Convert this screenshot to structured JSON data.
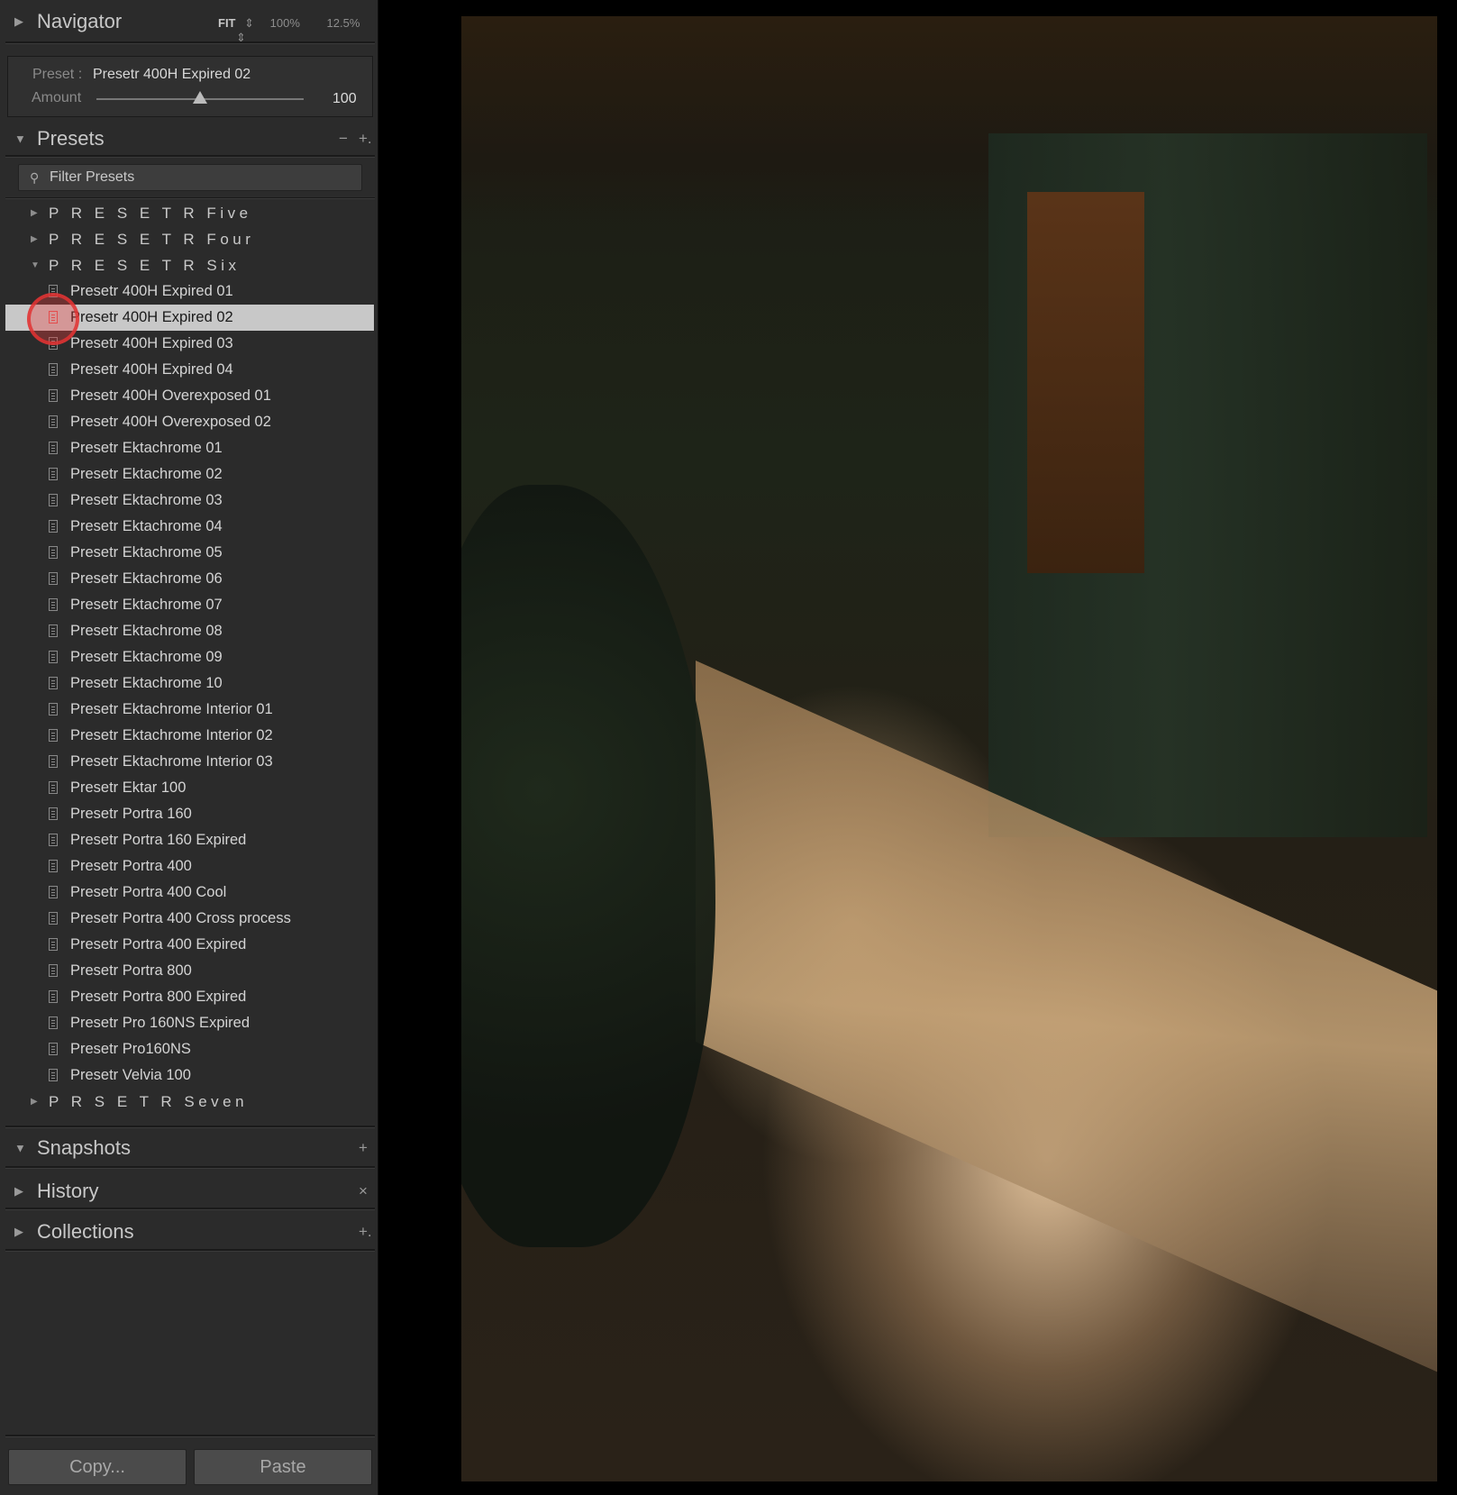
{
  "navigator": {
    "title": "Navigator",
    "zoom_options": [
      "FIT",
      "100%",
      "12.5%"
    ]
  },
  "preset_amount": {
    "preset_label": "Preset :",
    "preset_value": "Presetr 400H Expired 02",
    "amount_label": "Amount",
    "amount_value": "100",
    "amount_fraction": 0.5
  },
  "presets_panel": {
    "title": "Presets",
    "remove_label": "−",
    "add_label": "+.",
    "filter_placeholder": "Filter Presets",
    "folders": [
      {
        "name": "P R E S E T R  Five",
        "expanded": false
      },
      {
        "name": "P R E S E T R  Four",
        "expanded": false
      },
      {
        "name": "P R E S E T R  Six",
        "expanded": true,
        "selected_index": 1,
        "items": [
          "Presetr 400H Expired 01",
          "Presetr 400H Expired 02",
          "Presetr 400H Expired 03",
          "Presetr 400H Expired 04",
          "Presetr 400H Overexposed 01",
          "Presetr 400H Overexposed 02",
          "Presetr Ektachrome 01",
          "Presetr Ektachrome 02",
          "Presetr Ektachrome 03",
          "Presetr Ektachrome 04",
          "Presetr Ektachrome 05",
          "Presetr Ektachrome 06",
          "Presetr Ektachrome 07",
          "Presetr Ektachrome 08",
          "Presetr Ektachrome 09",
          "Presetr Ektachrome 10",
          "Presetr Ektachrome Interior 01",
          "Presetr Ektachrome Interior 02",
          "Presetr Ektachrome Interior 03",
          "Presetr Ektar 100",
          "Presetr Portra 160",
          "Presetr Portra 160 Expired",
          "Presetr Portra 400",
          "Presetr Portra 400 Cool",
          "Presetr Portra 400 Cross process",
          "Presetr Portra 400 Expired",
          "Presetr Portra 800",
          "Presetr Portra 800 Expired",
          "Presetr Pro 160NS Expired",
          "Presetr Pro160NS",
          "Presetr Velvia 100"
        ]
      },
      {
        "name": "P R S E T R  Seven",
        "expanded": false
      }
    ]
  },
  "snapshots": {
    "title": "Snapshots",
    "action": "+"
  },
  "history": {
    "title": "History",
    "action": "×"
  },
  "collections": {
    "title": "Collections",
    "action": "+."
  },
  "buttons": {
    "copy": "Copy...",
    "paste": "Paste"
  },
  "icons": {
    "collapsed": "triangle-right-icon",
    "expanded": "triangle-down-icon",
    "preset": "preset-file-icon",
    "search": "search-icon"
  },
  "colors": {
    "panel_bg": "#2b2b2b",
    "selected_row_bg": "#c8c8c8",
    "click_marker": "#e03c3c"
  }
}
